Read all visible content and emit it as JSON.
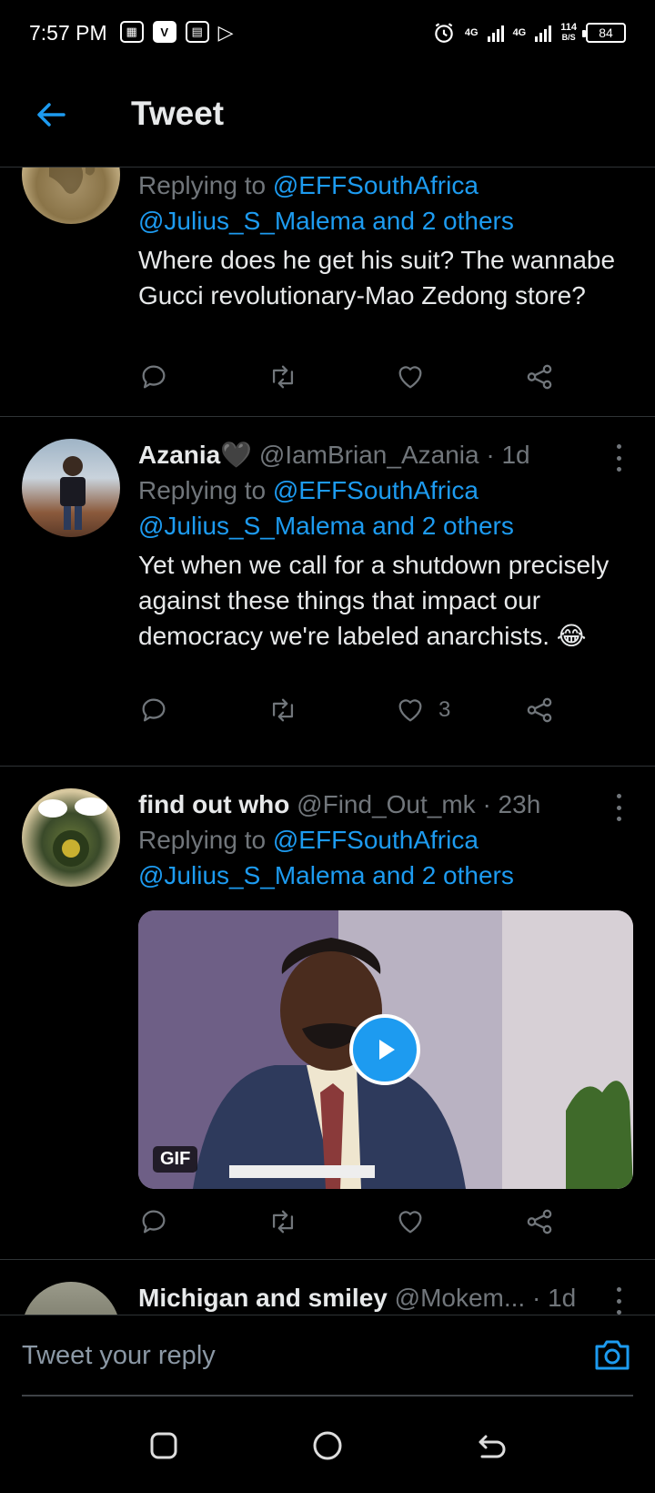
{
  "status": {
    "time": "7:57 PM",
    "apps": [
      "",
      "V",
      "",
      ""
    ],
    "net1": "4G",
    "net2": "4G",
    "speed": "114",
    "speed_unit": "B/S",
    "battery": "84"
  },
  "header": {
    "title": "Tweet"
  },
  "tweets": [
    {
      "replying_prefix": "Replying to ",
      "replying_primary": "@EFFSouthAfrica",
      "replying_rest": "@Julius_S_Malema and 2 others",
      "text": "Where does he get his suit? The wannabe Gucci revolutionary-Mao Zedong store?",
      "likes": ""
    },
    {
      "name": "Azania🖤",
      "handle": "@IamBrian_Azania",
      "time": "· 1d",
      "replying_prefix": "Replying to ",
      "replying_primary": "@EFFSouthAfrica",
      "replying_rest": "@Julius_S_Malema and 2 others",
      "text": "Yet when we call for a shutdown precisely against these things that impact our democracy we're labeled anarchists. 😂",
      "likes": "3"
    },
    {
      "name": "find out who",
      "handle": "@Find_Out_mk",
      "time": "· 23h",
      "replying_prefix": "Replying to ",
      "replying_primary": "@EFFSouthAfrica",
      "replying_rest": "@Julius_S_Malema and 2 others",
      "media_badge": "GIF",
      "likes": ""
    },
    {
      "name": "Michigan and smiley",
      "handle": "@Mokem...",
      "time": "· 1d"
    }
  ],
  "reply": {
    "placeholder": "Tweet your reply"
  },
  "icons": {
    "back": "arrow-left-icon",
    "reply": "reply-icon",
    "retweet": "retweet-icon",
    "like": "heart-icon",
    "share": "share-icon",
    "camera": "camera-icon",
    "more": "more-vertical-icon"
  },
  "colors": {
    "accent": "#1d9bf0",
    "muted": "#71767b",
    "background": "#000000"
  }
}
